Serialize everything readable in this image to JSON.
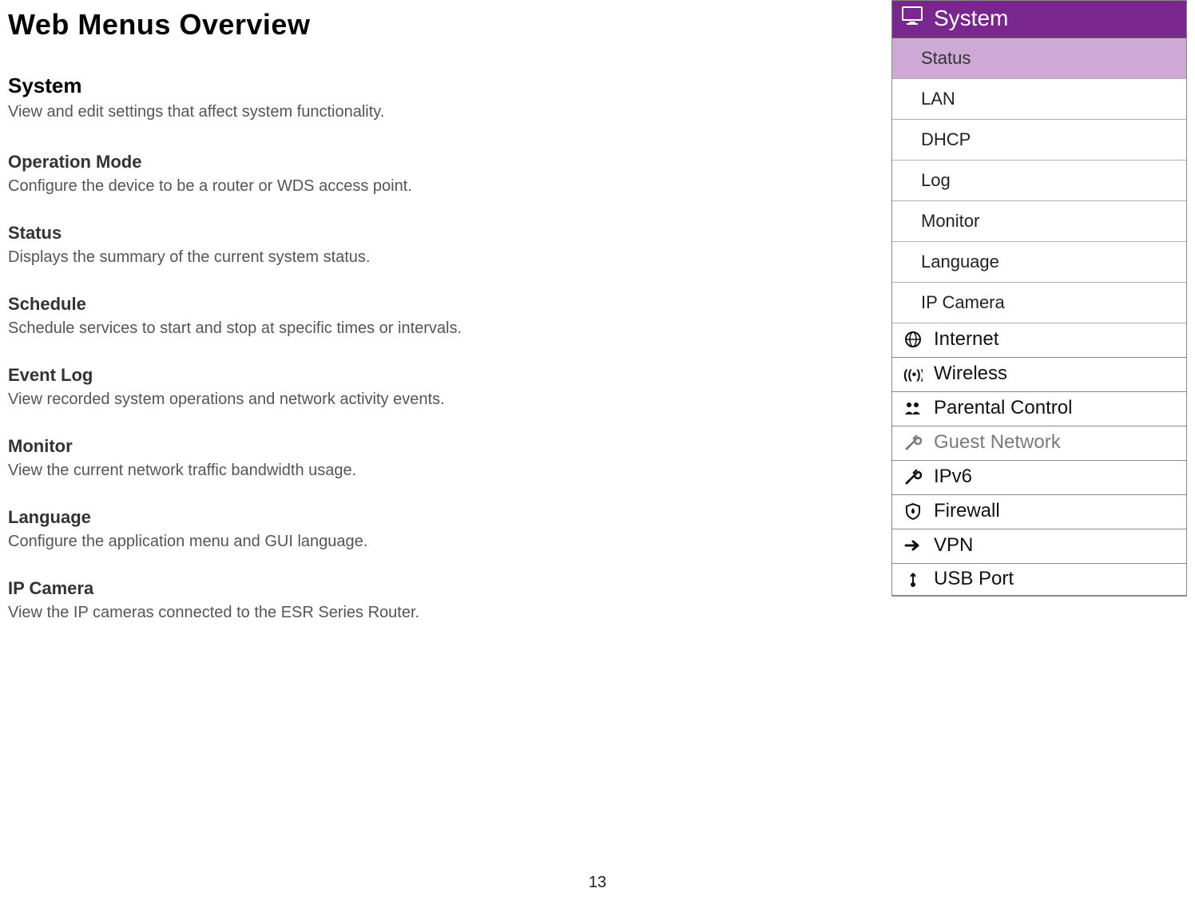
{
  "page": {
    "title": "Web Menus Overview",
    "number": "13"
  },
  "section": {
    "title": "System",
    "desc": "View and edit settings that affect system functionality."
  },
  "items": [
    {
      "title": "Operation Mode",
      "desc": "Configure the device to be a router or WDS access point."
    },
    {
      "title": "Status",
      "desc": "Displays the summary of the current system status."
    },
    {
      "title": "Schedule",
      "desc": "Schedule services to start and stop at specific times or intervals."
    },
    {
      "title": "Event Log",
      "desc": "View recorded system operations and network activity events."
    },
    {
      "title": "Monitor",
      "desc": "View the current network traffic bandwidth usage."
    },
    {
      "title": "Language",
      "desc": "Configure the application menu and GUI language."
    },
    {
      "title": "IP Camera",
      "desc": "View the IP cameras connected to the ESR Series Router."
    }
  ],
  "menu": {
    "header": "System",
    "submenu": [
      {
        "label": "Status",
        "active": true
      },
      {
        "label": "LAN",
        "active": false
      },
      {
        "label": "DHCP",
        "active": false
      },
      {
        "label": "Log",
        "active": false
      },
      {
        "label": "Monitor",
        "active": false
      },
      {
        "label": "Language",
        "active": false
      },
      {
        "label": "IP Camera",
        "active": false
      }
    ],
    "categories": [
      {
        "label": "Internet",
        "icon": "globe",
        "gray": false
      },
      {
        "label": "Wireless",
        "icon": "wifi",
        "gray": false
      },
      {
        "label": "Parental Control",
        "icon": "people",
        "gray": false
      },
      {
        "label": "Guest Network",
        "icon": "wrench",
        "gray": true
      },
      {
        "label": "IPv6",
        "icon": "wrench",
        "gray": false
      },
      {
        "label": "Firewall",
        "icon": "shield",
        "gray": false
      },
      {
        "label": "VPN",
        "icon": "arrow",
        "gray": false
      },
      {
        "label": "USB Port",
        "icon": "usb",
        "gray": false
      }
    ]
  }
}
